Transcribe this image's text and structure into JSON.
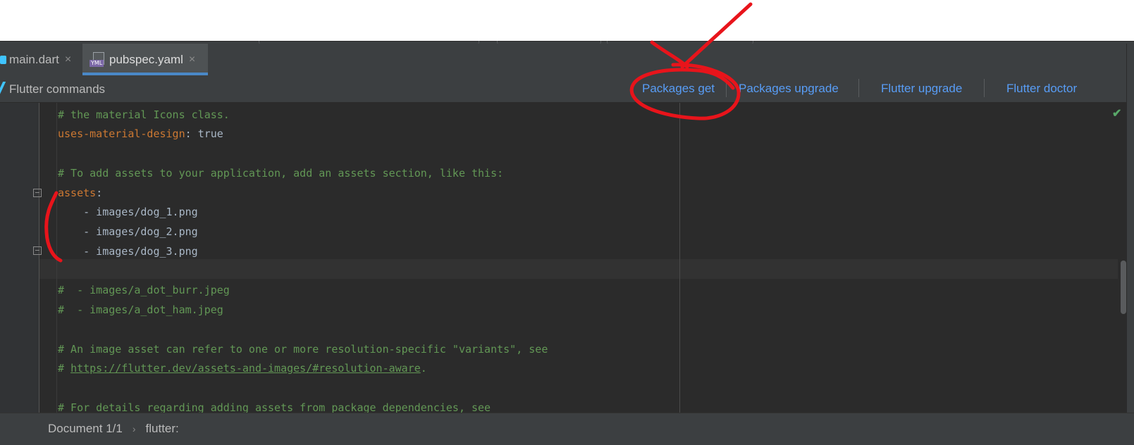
{
  "tabs": [
    {
      "label": "main.dart",
      "close": "×",
      "active": false
    },
    {
      "label": "pubspec.yaml",
      "close": "×",
      "active": true,
      "icon_label": "YML"
    }
  ],
  "flutter_commands": {
    "title": "Flutter commands",
    "packages_get": "Packages get",
    "packages_upgrade": "Packages upgrade",
    "flutter_upgrade": "Flutter upgrade",
    "flutter_doctor": "Flutter doctor"
  },
  "editor": {
    "lines": [
      {
        "comment": "# the material Icons class."
      },
      {
        "key": "uses-material-design",
        "sep": ": ",
        "value": "true"
      },
      {},
      {
        "comment": "# To add assets to your application, add an assets section, like this:"
      },
      {
        "key": "assets",
        "sep": ":"
      },
      {
        "text": "    - images/dog_1.png"
      },
      {
        "text": "    - images/dog_2.png"
      },
      {
        "text": "    - images/dog_3.png"
      },
      {},
      {
        "comment": "#  - images/a_dot_burr.jpeg"
      },
      {
        "comment": "#  - images/a_dot_ham.jpeg"
      },
      {},
      {
        "comment": "# An image asset can refer to one or more resolution-specific \"variants\", see"
      },
      {
        "comment_prefix": "# ",
        "link": "https://flutter.dev/assets-and-images/#resolution-aware",
        "comment_suffix": "."
      },
      {},
      {
        "comment": "# For details regarding adding assets from package dependencies, see"
      }
    ]
  },
  "statusbar": {
    "document": "Document 1/1",
    "separator": "›",
    "path": "flutter:"
  },
  "colors": {
    "comment": "#629755",
    "key": "#cc7832",
    "text": "#a9b7c6",
    "link": "#589df6",
    "annotation": "#e8141b"
  },
  "icons": [
    "dart-file-icon",
    "yaml-file-icon",
    "tab-close-icon",
    "flutter-icon",
    "inspection-ok-icon",
    "fold-icon"
  ]
}
